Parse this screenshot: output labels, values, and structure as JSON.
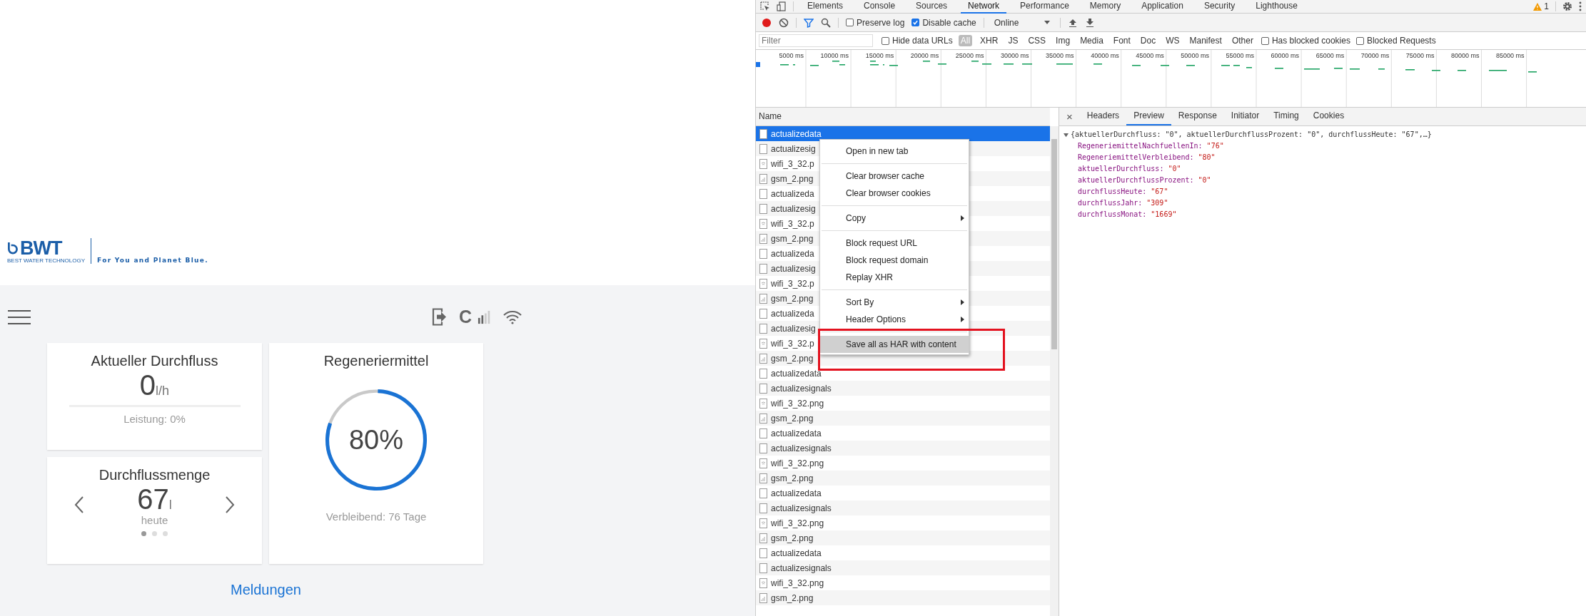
{
  "app": {
    "logo": {
      "brand": "BWT",
      "subline": "BEST WATER TECHNOLOGY",
      "tagline": "For You and Planet Blue."
    },
    "status": {
      "letter": "C"
    },
    "cards": [
      {
        "kind": "flow",
        "title": "Aktueller Durchfluss",
        "value": "0",
        "unit": "l/h",
        "level": 0,
        "caption": "Leistung: 0%"
      },
      {
        "kind": "amount",
        "title": "Durchflussmenge",
        "value": "67",
        "unit": "l",
        "caption": "heute",
        "pages": [
          {
            "selected": true
          },
          {
            "selected": false
          },
          {
            "selected": false
          }
        ]
      },
      {
        "kind": "ring",
        "title": "Regeneriermittel",
        "value": "80%",
        "level": 0.8,
        "caption": "Verbleibend: 76 Tage"
      }
    ],
    "link": "Meldungen"
  },
  "devtools": {
    "tabs": [
      {
        "label": "Elements",
        "selected": false
      },
      {
        "label": "Console",
        "selected": false
      },
      {
        "label": "Sources",
        "selected": false
      },
      {
        "label": "Network",
        "selected": true
      },
      {
        "label": "Performance",
        "selected": false
      },
      {
        "label": "Memory",
        "selected": false
      },
      {
        "label": "Application",
        "selected": false
      },
      {
        "label": "Security",
        "selected": false
      },
      {
        "label": "Lighthouse",
        "selected": false
      }
    ],
    "warnings": "1",
    "toolbar": {
      "checks": [
        {
          "label": "Preserve log",
          "checked": false
        },
        {
          "label": "Disable cache",
          "checked": true
        }
      ],
      "throttle": "Online"
    },
    "filter": {
      "placeholder": "Filter",
      "hide_data_urls": {
        "label": "Hide data URLs",
        "checked": false
      },
      "types": [
        {
          "label": "All",
          "selected": true
        },
        {
          "label": "XHR",
          "selected": false
        },
        {
          "label": "JS",
          "selected": false
        },
        {
          "label": "CSS",
          "selected": false
        },
        {
          "label": "Img",
          "selected": false
        },
        {
          "label": "Media",
          "selected": false
        },
        {
          "label": "Font",
          "selected": false
        },
        {
          "label": "Doc",
          "selected": false
        },
        {
          "label": "WS",
          "selected": false
        },
        {
          "label": "Manifest",
          "selected": false
        },
        {
          "label": "Other",
          "selected": false
        }
      ],
      "extra": [
        {
          "label": "Has blocked cookies",
          "checked": false
        },
        {
          "label": "Blocked Requests",
          "checked": false
        }
      ]
    },
    "timeline": {
      "ticks": [
        "5000 ms",
        "10000 ms",
        "15000 ms",
        "20000 ms",
        "25000 ms",
        "30000 ms",
        "35000 ms",
        "40000 ms",
        "45000 ms",
        "50000 ms",
        "55000 ms",
        "60000 ms",
        "65000 ms",
        "70000 ms",
        "75000 ms",
        "80000 ms",
        "85000 ms"
      ]
    },
    "requests": {
      "header": "Name",
      "rows": [
        {
          "name": "actualizedata",
          "kind": "document",
          "selected": true
        },
        {
          "name": "actualizesig",
          "kind": "document",
          "selected": false
        },
        {
          "name": "wifi_3_32.p",
          "kind": "wifi-image",
          "selected": false
        },
        {
          "name": "gsm_2.png",
          "kind": "signal-image",
          "selected": false
        },
        {
          "name": "actualizeda",
          "kind": "document",
          "selected": false
        },
        {
          "name": "actualizesig",
          "kind": "document",
          "selected": false
        },
        {
          "name": "wifi_3_32.p",
          "kind": "wifi-image",
          "selected": false
        },
        {
          "name": "gsm_2.png",
          "kind": "signal-image",
          "selected": false
        },
        {
          "name": "actualizeda",
          "kind": "document",
          "selected": false
        },
        {
          "name": "actualizesig",
          "kind": "document",
          "selected": false
        },
        {
          "name": "wifi_3_32.p",
          "kind": "wifi-image",
          "selected": false
        },
        {
          "name": "gsm_2.png",
          "kind": "signal-image",
          "selected": false
        },
        {
          "name": "actualizeda",
          "kind": "document",
          "selected": false
        },
        {
          "name": "actualizesig",
          "kind": "document",
          "selected": false
        },
        {
          "name": "wifi_3_32.p",
          "kind": "wifi-image",
          "selected": false
        },
        {
          "name": "gsm_2.png",
          "kind": "signal-image",
          "selected": false
        },
        {
          "name": "actualizedata",
          "kind": "document",
          "selected": false
        },
        {
          "name": "actualizesignals",
          "kind": "document",
          "selected": false
        },
        {
          "name": "wifi_3_32.png",
          "kind": "wifi-image",
          "selected": false
        },
        {
          "name": "gsm_2.png",
          "kind": "signal-image",
          "selected": false
        },
        {
          "name": "actualizedata",
          "kind": "document",
          "selected": false
        },
        {
          "name": "actualizesignals",
          "kind": "document",
          "selected": false
        },
        {
          "name": "wifi_3_32.png",
          "kind": "wifi-image",
          "selected": false
        },
        {
          "name": "gsm_2.png",
          "kind": "signal-image",
          "selected": false
        },
        {
          "name": "actualizedata",
          "kind": "document",
          "selected": false
        },
        {
          "name": "actualizesignals",
          "kind": "document",
          "selected": false
        },
        {
          "name": "wifi_3_32.png",
          "kind": "wifi-image",
          "selected": false
        },
        {
          "name": "gsm_2.png",
          "kind": "signal-image",
          "selected": false
        },
        {
          "name": "actualizedata",
          "kind": "document",
          "selected": false
        },
        {
          "name": "actualizesignals",
          "kind": "document",
          "selected": false
        },
        {
          "name": "wifi_3_32.png",
          "kind": "wifi-image",
          "selected": false
        },
        {
          "name": "gsm_2.png",
          "kind": "signal-image",
          "selected": false
        }
      ]
    },
    "detail": {
      "close": "×",
      "tabs": [
        {
          "label": "Headers",
          "selected": false
        },
        {
          "label": "Preview",
          "selected": true
        },
        {
          "label": "Response",
          "selected": false
        },
        {
          "label": "Initiator",
          "selected": false
        },
        {
          "label": "Timing",
          "selected": false
        },
        {
          "label": "Cookies",
          "selected": false
        }
      ],
      "preview": {
        "summary": "{aktuellerDurchfluss: \"0\", aktuellerDurchflussProzent: \"0\", durchflussHeute: \"67\",…}",
        "expanded": true,
        "properties": [
          {
            "key": "RegeneriemittelNachfuellenIn:",
            "value": "\"76\""
          },
          {
            "key": "RegeneriemittelVerbleibend:",
            "value": "\"80\""
          },
          {
            "key": "aktuellerDurchfluss:",
            "value": "\"0\""
          },
          {
            "key": "aktuellerDurchflussProzent:",
            "value": "\"0\""
          },
          {
            "key": "durchflussHeute:",
            "value": "\"67\""
          },
          {
            "key": "durchflussJahr:",
            "value": "\"309\""
          },
          {
            "key": "durchflussMonat:",
            "value": "\"1669\""
          }
        ]
      }
    },
    "context_menu": {
      "groups": [
        [
          {
            "label": "Open in new tab",
            "submenu": false,
            "highlighted": false
          }
        ],
        [
          {
            "label": "Clear browser cache",
            "submenu": false,
            "highlighted": false
          },
          {
            "label": "Clear browser cookies",
            "submenu": false,
            "highlighted": false
          }
        ],
        [
          {
            "label": "Copy",
            "submenu": true,
            "highlighted": false
          }
        ],
        [
          {
            "label": "Block request URL",
            "submenu": false,
            "highlighted": false
          },
          {
            "label": "Block request domain",
            "submenu": false,
            "highlighted": false
          },
          {
            "label": "Replay XHR",
            "submenu": false,
            "highlighted": false
          }
        ],
        [
          {
            "label": "Sort By",
            "submenu": true,
            "highlighted": false
          },
          {
            "label": "Header Options",
            "submenu": true,
            "highlighted": false
          }
        ],
        [
          {
            "label": "Save all as HAR with content",
            "submenu": false,
            "highlighted": true
          }
        ]
      ]
    }
  }
}
